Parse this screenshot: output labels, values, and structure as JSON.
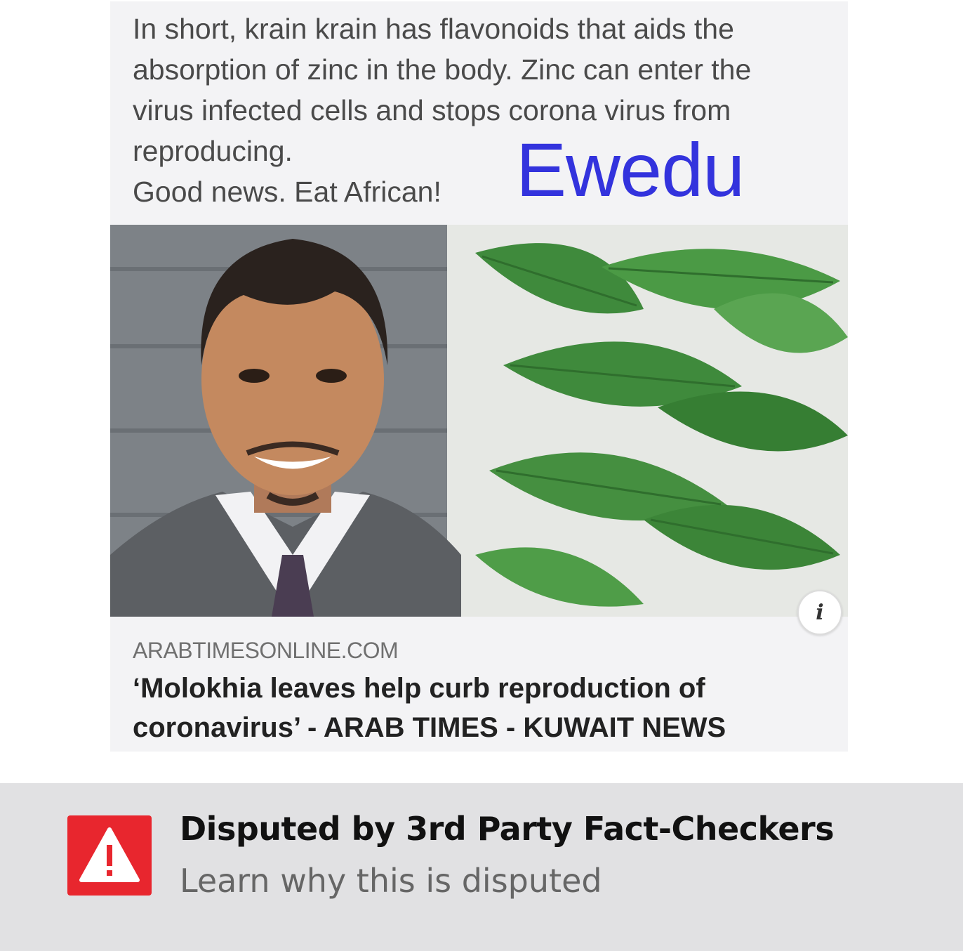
{
  "post": {
    "text_lines": [
      "In short, krain krain has flavonoids that aids the",
      "absorption of zinc in the body. Zinc can enter the",
      "virus infected cells and stops corona virus from",
      "reproducing.",
      "Good news. Eat African!"
    ],
    "overlay_word": "Ewedu",
    "overlay_color": "#3333dd"
  },
  "link_preview": {
    "domain": "ARABTIMESONLINE.COM",
    "title_lines": [
      "‘Molokhia leaves help curb reproduction of",
      "coronavirus’ - ARAB TIMES - KUWAIT NEWS"
    ],
    "info_icon": "info-icon"
  },
  "dispute": {
    "title": "Disputed by 3rd Party Fact-Checkers",
    "link_text": "Learn why this is disputed",
    "icon": "warning-icon",
    "icon_color": "#e8262e"
  }
}
